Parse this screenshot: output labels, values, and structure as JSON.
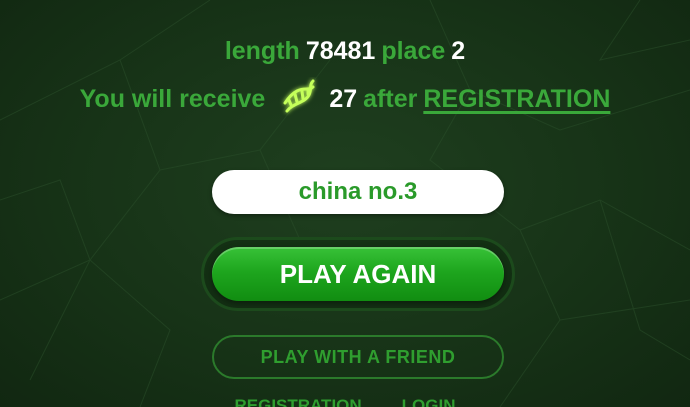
{
  "stats": {
    "length_label": "length",
    "length_value": "78481",
    "place_label": "place",
    "place_value": "2"
  },
  "reward": {
    "prefix": "You will receive",
    "icon": "dna-icon",
    "amount": "27",
    "after": "after",
    "link": "REGISTRATION"
  },
  "nickname": {
    "value": "china no.3"
  },
  "buttons": {
    "play_again": "PLAY AGAIN",
    "play_with_friend": "PLAY WITH A FRIEND"
  },
  "bottom_links": {
    "registration": "REGISTRATION",
    "login": "LOGIN"
  },
  "colors": {
    "accent_green": "#3aa83a",
    "button_green": "#1ea61e",
    "background": "#173317",
    "dna_glow": "#c4ff5a"
  }
}
